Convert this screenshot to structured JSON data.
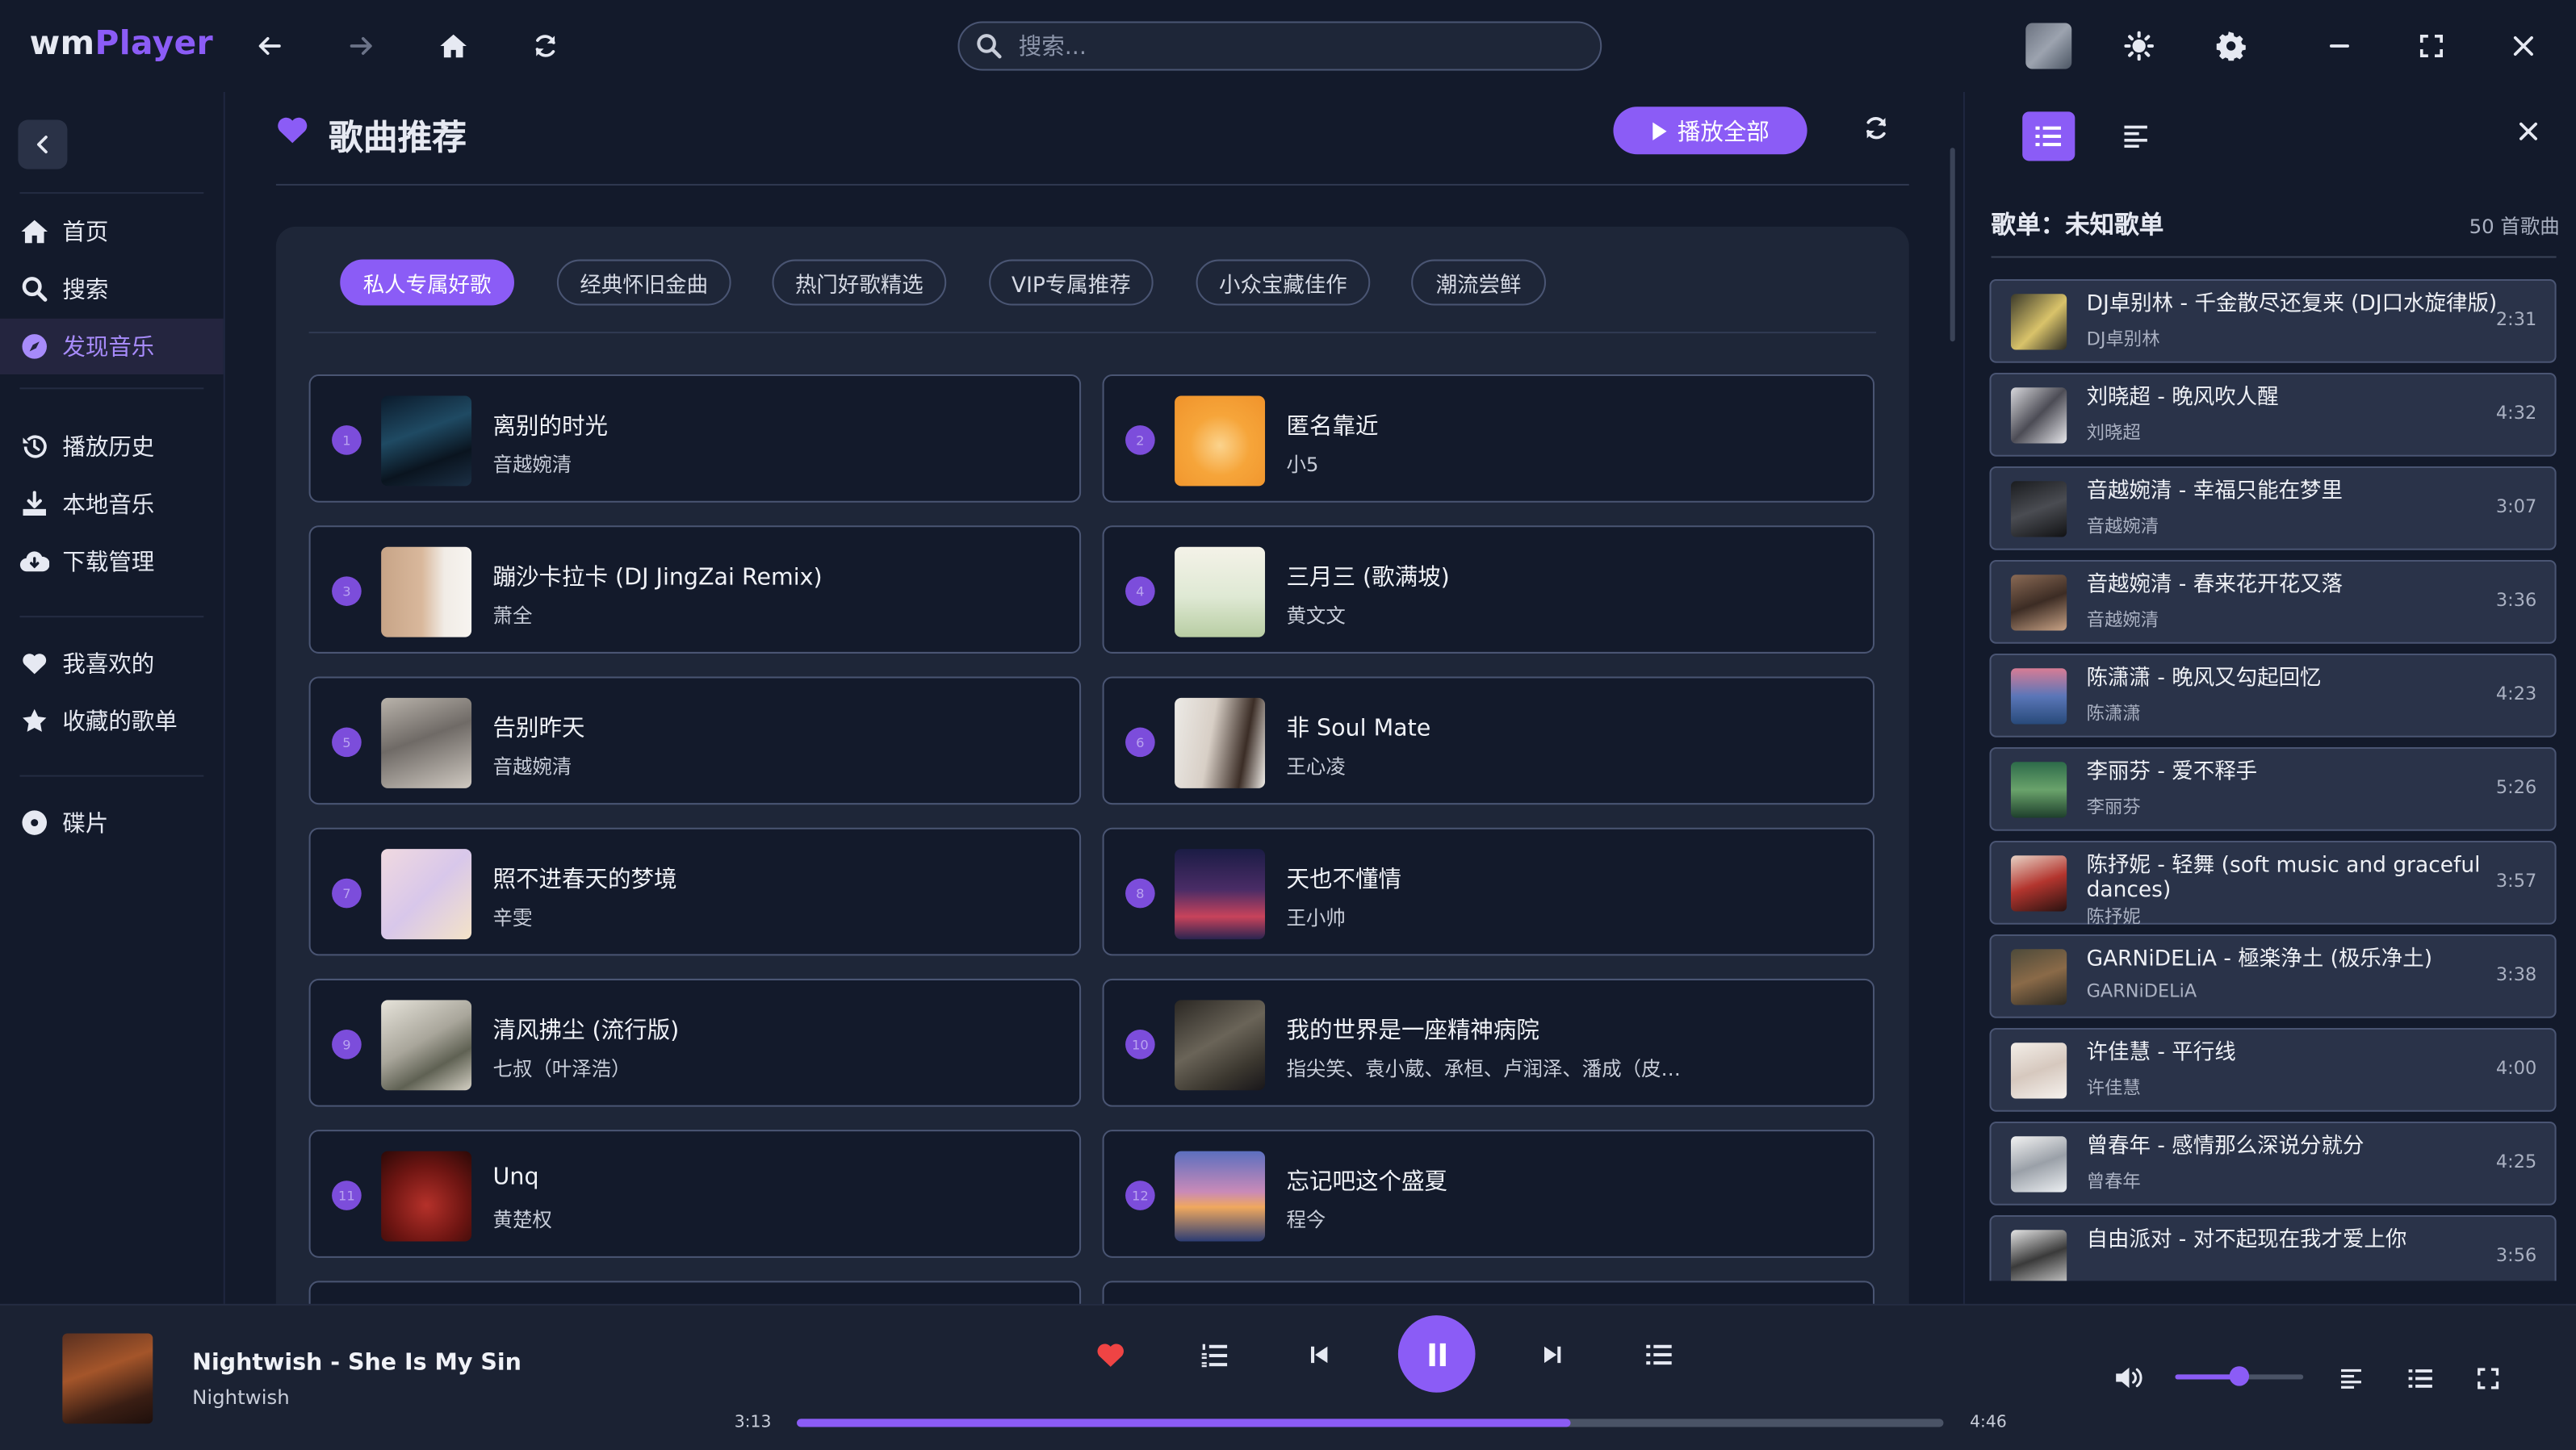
{
  "app": {
    "logo_prefix": "wm",
    "logo_suffix": "Player"
  },
  "search": {
    "placeholder": "搜索..."
  },
  "sidebar": {
    "items": [
      {
        "label": "首页",
        "icon": "home-icon"
      },
      {
        "label": "搜索",
        "icon": "search-icon"
      },
      {
        "label": "发现音乐",
        "icon": "compass-icon",
        "active": true
      },
      {
        "label": "播放历史",
        "icon": "history-icon"
      },
      {
        "label": "本地音乐",
        "icon": "download-icon"
      },
      {
        "label": "下载管理",
        "icon": "cloud-download-icon"
      },
      {
        "label": "我喜欢的",
        "icon": "heart-icon"
      },
      {
        "label": "收藏的歌单",
        "icon": "star-icon"
      },
      {
        "label": "碟片",
        "icon": "disc-icon"
      }
    ]
  },
  "main": {
    "title": "歌曲推荐",
    "play_all": "播放全部",
    "tabs": [
      {
        "label": "私人专属好歌",
        "active": true
      },
      {
        "label": "经典怀旧金曲"
      },
      {
        "label": "热门好歌精选"
      },
      {
        "label": "VIP专属推荐"
      },
      {
        "label": "小众宝藏佳作"
      },
      {
        "label": "潮流尝鲜"
      }
    ],
    "songs": [
      {
        "num": "1",
        "title": "离别的时光",
        "artist": "音越婉清"
      },
      {
        "num": "2",
        "title": "匿名靠近",
        "artist": "小5"
      },
      {
        "num": "3",
        "title": "蹦沙卡拉卡 (DJ JingZai Remix)",
        "artist": "萧全"
      },
      {
        "num": "4",
        "title": "三月三 (歌满坡)",
        "artist": "黄文文"
      },
      {
        "num": "5",
        "title": "告别昨天",
        "artist": "音越婉清"
      },
      {
        "num": "6",
        "title": "非 Soul Mate",
        "artist": "王心凌"
      },
      {
        "num": "7",
        "title": "照不进春天的梦境",
        "artist": "辛雯"
      },
      {
        "num": "8",
        "title": "天也不懂情",
        "artist": "王小帅"
      },
      {
        "num": "9",
        "title": "清风拂尘 (流行版)",
        "artist": "七叔（叶泽浩）"
      },
      {
        "num": "10",
        "title": "我的世界是一座精神病院",
        "artist": "指尖笑、袁小葳、承桓、卢润泽、潘成（皮…"
      },
      {
        "num": "11",
        "title": "Unq",
        "artist": "黄楚权"
      },
      {
        "num": "12",
        "title": "忘记吧这个盛夏",
        "artist": "程今"
      }
    ]
  },
  "queue": {
    "title": "歌单：未知歌单",
    "count": "50 首歌曲",
    "items": [
      {
        "title": "DJ卓别林 - 千金散尽还复来 (DJ口水旋律版)",
        "artist": "DJ卓别林",
        "duration": "2:31"
      },
      {
        "title": "刘晓超 - 晚风吹人醒",
        "artist": "刘晓超",
        "duration": "4:32"
      },
      {
        "title": "音越婉清 - 幸福只能在梦里",
        "artist": "音越婉清",
        "duration": "3:07"
      },
      {
        "title": "音越婉清 - 春来花开花又落",
        "artist": "音越婉清",
        "duration": "3:36"
      },
      {
        "title": "陈潇潇 - 晚风又勾起回忆",
        "artist": "陈潇潇",
        "duration": "4:23"
      },
      {
        "title": "李丽芬 - 爱不释手",
        "artist": "李丽芬",
        "duration": "5:26"
      },
      {
        "title": "陈抒妮 - 轻舞 (soft music and graceful dances)",
        "artist": "陈抒妮",
        "duration": "3:57"
      },
      {
        "title": "GARNiDELiA - 極楽浄土 (极乐净土)",
        "artist": "GARNiDELiA",
        "duration": "3:38"
      },
      {
        "title": "许佳慧 - 平行线",
        "artist": "许佳慧",
        "duration": "4:00"
      },
      {
        "title": "曾春年 - 感情那么深说分就分",
        "artist": "曾春年",
        "duration": "4:25"
      },
      {
        "title": "自由派对 - 对不起现在我才爱上你",
        "artist": "",
        "duration": "3:56"
      }
    ]
  },
  "player": {
    "title": "Nightwish - She Is My Sin",
    "artist": "Nightwish",
    "current_time": "3:13",
    "total_time": "4:46",
    "progress": 0.675,
    "volume": 0.5
  },
  "colors": {
    "accent": "#8b5cf6",
    "background": "#131a2b",
    "heart": "#ef4444"
  }
}
